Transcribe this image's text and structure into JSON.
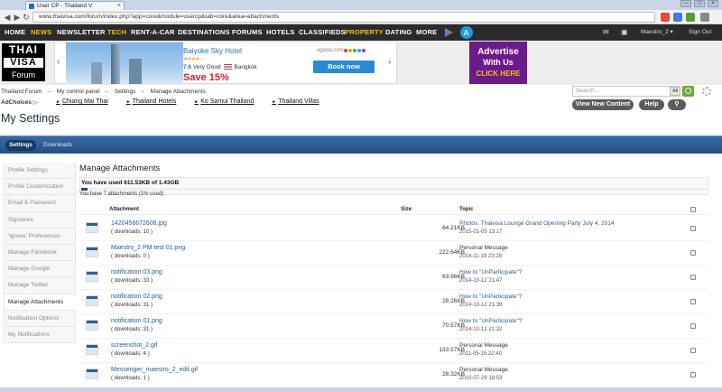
{
  "browser": {
    "tab_title": "User CP - Thailand V",
    "tab_close": "×",
    "url": "www.thaivisa.com/forum/index.php?app=core&module=usercp&tab=core&area=attachments",
    "window_buttons": [
      "–",
      "□",
      "×"
    ]
  },
  "sitenav": {
    "items": [
      "HOME",
      "NEWS",
      "NEWSLETTER",
      "TECH",
      "RENT-A-CAR",
      "DESTINATIONS",
      "FORUMS",
      "HOTELS",
      "CLASSIFIEDS",
      "PROPERTY",
      "DATING",
      "MORE"
    ],
    "highlight_color": "#f3c10f",
    "user": "Maestro_2 ▾",
    "signout": "Sign Out"
  },
  "logo": {
    "line1": "THAI",
    "line2": "VISA",
    "line3": "Forum"
  },
  "hotel_ad": {
    "name": "Baiyoke Sky Hotel",
    "stars": "★★★★☆",
    "score": "7.6",
    "rating_word": "Very Good",
    "city": "Bangkok",
    "save": "Save 15%",
    "brand": "agoda.com",
    "book": "Book now",
    "prev": "‹",
    "next": "›"
  },
  "advert": {
    "line1": "Advertise",
    "line2": "With Us",
    "line3": "CLICK HERE"
  },
  "breadcrumb": [
    "Thailand Forum",
    "My control panel",
    "Settings",
    "Manage Attachments"
  ],
  "adchoices": {
    "label": "AdChoices",
    "mark": "▷",
    "links": [
      "Chiang Mai Thai",
      "Thailand Hotels",
      "Ko Samui Thailand",
      "Thailand Villas"
    ]
  },
  "search": {
    "placeholder": "Search...",
    "scope": "All"
  },
  "buttons": {
    "view_new": "View New Content",
    "help": "Help",
    "pin": "⚲"
  },
  "page_title": "My Settings",
  "tabs": {
    "settings": "Settings",
    "downloads": "Downloads"
  },
  "sidebar": [
    "Profile Settings",
    "Profile Customization",
    "Email & Password",
    "Signature",
    "'Ignore' Preferences",
    "Manage Facebook",
    "Manage Google",
    "Manage Twitter",
    "Manage Attachments",
    "Notification Options",
    "My Notifications"
  ],
  "sidebar_active_index": 8,
  "main": {
    "heading": "Manage Attachments",
    "used": "You have used 611.53KB of 1.43GB",
    "used_fraction": 0.01,
    "count_text": "You have 7 attachments (1% used)",
    "columns": {
      "attachment": "Attachment",
      "size": "Size",
      "topic": "Topic"
    },
    "rows": [
      {
        "file": "1420456672608.jpg",
        "downloads": "( downloads: 10 )",
        "size": "64.21KB",
        "topic": "Photos: Thaivisa Lounge Grand Opening Party July 4, 2014",
        "topic_is_link": true,
        "date": "2015-01-05 13:17"
      },
      {
        "file": "Maestro_2 PM test 01.png",
        "downloads": "( downloads: 0 )",
        "size": "222.64KB",
        "topic": "Personal Message",
        "topic_is_link": false,
        "date": "2014-11-19 23:28"
      },
      {
        "file": "notification 03.png",
        "downloads": "( downloads: 33 )",
        "size": "63.96KB",
        "topic": "How to \"UnParticipate\"?",
        "topic_is_link": true,
        "date": "2014-10-12 21:47"
      },
      {
        "file": "notification 02.png",
        "downloads": "( downloads: 31 )",
        "size": "28.26KB",
        "topic": "How to \"UnParticipate\"?",
        "topic_is_link": true,
        "date": "2014-10-12 21:39"
      },
      {
        "file": "notification 01.png",
        "downloads": "( downloads: 31 )",
        "size": "70.57KB",
        "topic": "How to \"UnParticipate\"?",
        "topic_is_link": true,
        "date": "2014-10-12 21:32"
      },
      {
        "file": "screenshot_2.gif",
        "downloads": "( downloads: 4 )",
        "size": "133.57KB",
        "topic": "Personal Message",
        "topic_is_link": false,
        "date": "2011-05-15 22:40"
      },
      {
        "file": "Messenger_maestro_2_edit.gif",
        "downloads": "( downloads: 1 )",
        "size": "28.32KB",
        "topic": "Personal Message",
        "topic_is_link": false,
        "date": "2010-07-29 18:53"
      }
    ]
  }
}
